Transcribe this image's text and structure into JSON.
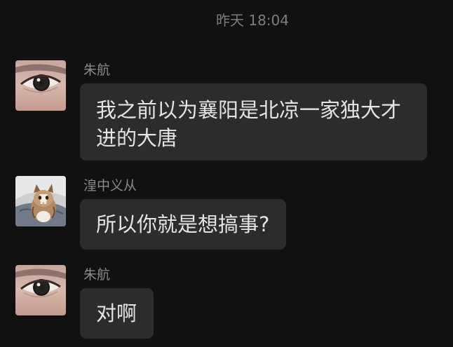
{
  "timestamp": "昨天 18:04",
  "messages": [
    {
      "sender": "朱航",
      "avatar_icon": "eye-avatar-icon",
      "text": "我之前以为襄阳是北凉一家独大才进的大唐"
    },
    {
      "sender": "湟中义从",
      "avatar_icon": "cat-avatar-icon",
      "text": "所以你就是想搞事?"
    },
    {
      "sender": "朱航",
      "avatar_icon": "eye-avatar-icon",
      "text": "对啊"
    }
  ],
  "colors": {
    "background": "#111111",
    "bubble": "#2c2c2c",
    "message_text": "#e4e4e4",
    "meta_text": "#8a8a8a"
  }
}
